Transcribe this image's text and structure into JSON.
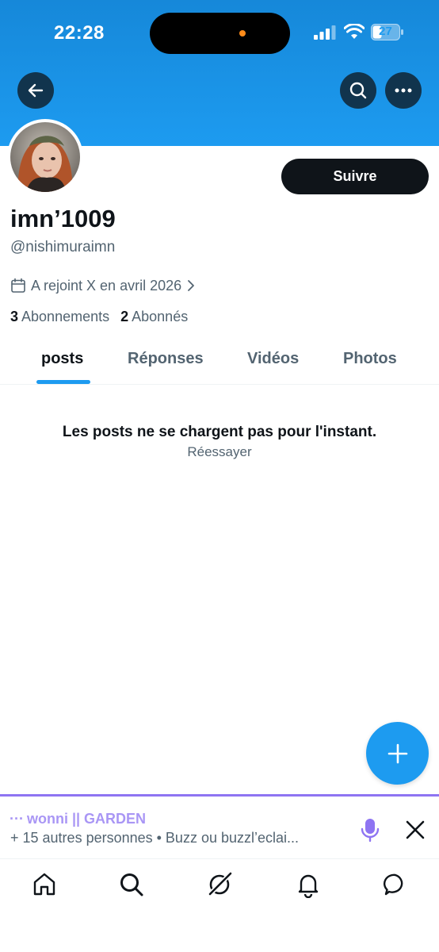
{
  "status_bar": {
    "time": "22:28",
    "battery": "27"
  },
  "profile": {
    "display_name": "imn’1009",
    "handle": "@nishimuraimn",
    "joined": "A rejoint X en avril 2026",
    "following_count": "3",
    "following_label": "Abonnements",
    "followers_count": "2",
    "followers_label": "Abonnés",
    "follow_label": "Suivre"
  },
  "tabs": [
    {
      "label": "posts",
      "active": true
    },
    {
      "label": "Réponses",
      "active": false
    },
    {
      "label": "Vidéos",
      "active": false
    },
    {
      "label": "Photos",
      "active": false
    }
  ],
  "feed": {
    "error_message": "Les posts ne se chargent pas pour l'instant.",
    "retry_label": "Réessayer"
  },
  "space": {
    "title": "wonni || GARDEN",
    "subtitle": "+ 15 autres personnes • Buzz ou buzzl’eclai..."
  },
  "colors": {
    "banner": "#1d9bf0",
    "accent": "#1d9bf0",
    "space_accent": "#8e74f2",
    "text_primary": "#0f1419",
    "text_secondary": "#536471"
  },
  "icons": {
    "back": "arrow-left-icon",
    "search": "search-icon",
    "more": "more-horizontal-icon",
    "calendar": "calendar-icon",
    "compose": "plus-icon",
    "mic": "microphone-icon",
    "close": "close-icon",
    "nav": [
      "home-icon",
      "search-icon",
      "grok-icon",
      "bell-icon",
      "message-icon"
    ]
  }
}
